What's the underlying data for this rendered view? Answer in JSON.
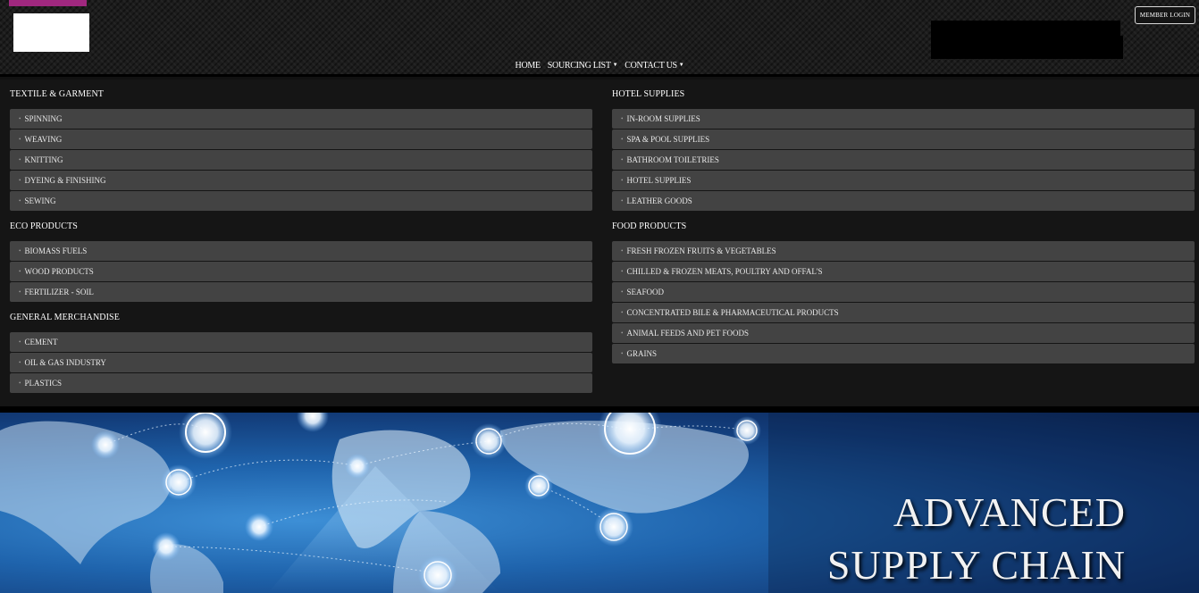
{
  "colors": {
    "accent": "#a0287f",
    "panel": "#434343",
    "background": "#151515"
  },
  "header": {
    "login_label": "MEMBER LOGIN",
    "nav": [
      {
        "label": "HOME",
        "dropdown": false
      },
      {
        "label": "SOURCING LIST",
        "dropdown": true
      },
      {
        "label": "CONTACT US",
        "dropdown": true
      }
    ]
  },
  "menu": {
    "left": [
      {
        "title": "TEXTILE & GARMENT",
        "items": [
          "SPINNING",
          "WEAVING",
          "KNITTING",
          "DYEING & FINISHING",
          "SEWING"
        ]
      },
      {
        "title": "ECO PRODUCTS",
        "items": [
          "BIOMASS FUELS",
          "WOOD PRODUCTS",
          "FERTILIZER - SOIL"
        ]
      },
      {
        "title": "GENERAL MERCHANDISE",
        "items": [
          "CEMENT",
          "OIL & GAS INDUSTRY",
          "PLASTICS"
        ]
      }
    ],
    "right": [
      {
        "title": "HOTEL SUPPLIES",
        "items": [
          "IN-ROOM SUPPLIES",
          "SPA & POOL SUPPLIES",
          "BATHROOM TOILETRIES",
          "HOTEL SUPPLIES",
          "LEATHER GOODS"
        ]
      },
      {
        "title": "FOOD PRODUCTS",
        "items": [
          "FRESH FROZEN FRUITS & VEGETABLES",
          "CHILLED & FROZEN MEATS, POULTRY AND OFFAL'S",
          "SEAFOOD",
          "CONCENTRATED BILE & PHARMACEUTICAL PRODUCTS",
          "ANIMAL FEEDS AND PET FOODS",
          "GRAINS"
        ]
      }
    ]
  },
  "hero": {
    "line1": "ADVANCED",
    "line2": "SUPPLY CHAIN"
  }
}
